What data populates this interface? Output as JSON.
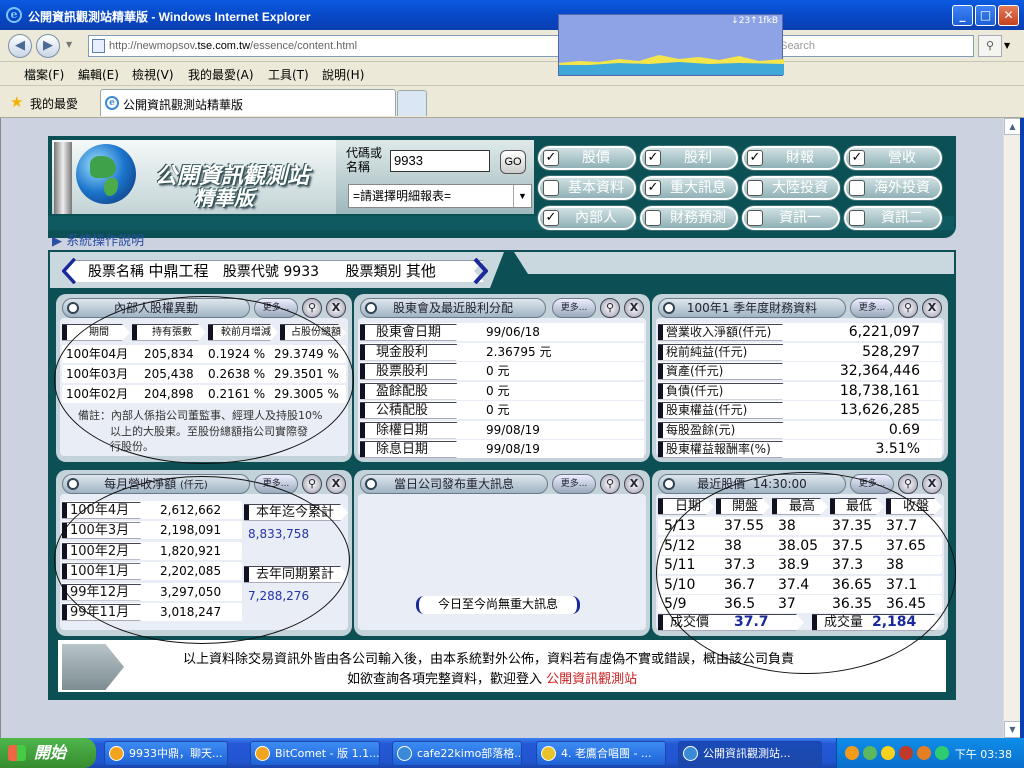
{
  "window": {
    "title": "公開資訊觀測站精華版 - Windows Internet Explorer"
  },
  "netmeter": {
    "rate": "↓23↑1fkB"
  },
  "address": {
    "url_gray1": "http://newmopsov",
    "url_black": ".tse.com.tw",
    "url_gray2": "/essence/content.html",
    "search_placeholder": "Yahoo! Search",
    "yahoo": "Y!"
  },
  "menu": [
    "檔案(F)",
    "編輯(E)",
    "檢視(V)",
    "我的最愛(A)",
    "工具(T)",
    "說明(H)"
  ],
  "favorites": {
    "label": "我的最愛",
    "tab": "公開資訊觀測站精華版"
  },
  "banner": {
    "title1": "公開資訊觀測站",
    "title2": "精華版",
    "code_label1": "代碼或",
    "code_label2": "名稱",
    "code_value": "9933",
    "go": "GO",
    "select": "=請選擇明細報表=",
    "nav": [
      {
        "label": "股價",
        "checked": true
      },
      {
        "label": "股利",
        "checked": true
      },
      {
        "label": "財報",
        "checked": true
      },
      {
        "label": "營收",
        "checked": true
      },
      {
        "label": "基本資料",
        "checked": false
      },
      {
        "label": "重大訊息",
        "checked": true
      },
      {
        "label": "大陸投資",
        "checked": false
      },
      {
        "label": "海外投資",
        "checked": false
      },
      {
        "label": "內部人",
        "checked": true
      },
      {
        "label": "財務預測",
        "checked": false
      },
      {
        "label": "資訊一",
        "checked": false
      },
      {
        "label": "資訊二",
        "checked": false
      }
    ]
  },
  "help": "▶ 系統操作說明",
  "stock": {
    "name_label": "股票名稱",
    "name": "中鼎工程",
    "code_label": "股票代號",
    "code": "9933",
    "type_label": "股票類別",
    "type": "其他"
  },
  "common": {
    "more": "更多...",
    "zoom": "🔍",
    "close": "X"
  },
  "insider": {
    "title": "內部人股權異動",
    "headers": [
      "期間",
      "持有張數",
      "較前月增減",
      "占股份總額"
    ],
    "rows": [
      [
        "100年04月",
        "205,834",
        "0.1924 %",
        "29.3749 %"
      ],
      [
        "100年03月",
        "205,438",
        "0.2638 %",
        "29.3501 %"
      ],
      [
        "100年02月",
        "204,898",
        "0.2161 %",
        "29.3005 %"
      ]
    ],
    "note1": "備註：內部人係指公司董監事、經理人及持股10%",
    "note2": "以上的大股東。至股份總額指公司實際發",
    "note3": "行股份。"
  },
  "dividend": {
    "title": "股東會及最近股利分配",
    "rows": [
      {
        "label": "股東會日期",
        "value": "99/06/18"
      },
      {
        "label": "現金股利",
        "value": "2.36795 元"
      },
      {
        "label": "股票股利",
        "value": "0 元"
      },
      {
        "label": "盈餘配股",
        "value": "0 元"
      },
      {
        "label": "公積配股",
        "value": "0 元"
      },
      {
        "label": "除權日期",
        "value": "99/08/19"
      },
      {
        "label": "除息日期",
        "value": "99/08/19"
      }
    ]
  },
  "finance": {
    "title": "100年1 季年度財務資料",
    "rows": [
      {
        "label": "營業收入淨額(仟元)",
        "value": "6,221,097"
      },
      {
        "label": "稅前純益(仟元)",
        "value": "528,297"
      },
      {
        "label": "資產(仟元)",
        "value": "32,364,446"
      },
      {
        "label": "負債(仟元)",
        "value": "18,738,161"
      },
      {
        "label": "股東權益(仟元)",
        "value": "13,626,285"
      },
      {
        "label": "每股盈餘(元)",
        "value": "0.69"
      },
      {
        "label": "股東權益報酬率(%)",
        "value": "3.51%"
      }
    ]
  },
  "revenue": {
    "title": "每月營收淨額",
    "unit": "(仟元)",
    "rows": [
      {
        "label": "100年4月",
        "value": "2,612,662"
      },
      {
        "label": "100年3月",
        "value": "2,198,091"
      },
      {
        "label": "100年2月",
        "value": "1,820,921"
      },
      {
        "label": "100年1月",
        "value": "2,202,085"
      },
      {
        "label": "99年12月",
        "value": "3,297,050"
      },
      {
        "label": "99年11月",
        "value": "3,018,247"
      }
    ],
    "ytd_label": "本年迄今累計",
    "ytd_value": "8,833,758",
    "lastyear_label": "去年同期累計",
    "lastyear_value": "7,288,276"
  },
  "news": {
    "title": "當日公司發布重大訊息",
    "empty": "今日至今尚無重大訊息"
  },
  "price": {
    "title": "最近股價",
    "time": "14:30:00",
    "headers": [
      "日期",
      "開盤",
      "最高",
      "最低",
      "收盤"
    ],
    "rows": [
      [
        "5/13",
        "37.55",
        "38",
        "37.35",
        "37.7"
      ],
      [
        "5/12",
        "38",
        "38.05",
        "37.5",
        "37.65"
      ],
      [
        "5/11",
        "37.3",
        "38.9",
        "37.3",
        "38"
      ],
      [
        "5/10",
        "36.7",
        "37.4",
        "36.65",
        "37.1"
      ],
      [
        "5/9",
        "36.5",
        "37",
        "36.35",
        "36.45"
      ]
    ],
    "deal_label": "成交價",
    "deal": "37.7",
    "vol_label": "成交量",
    "vol": "2,184"
  },
  "footer": {
    "line1": "以上資料除交易資訊外皆由各公司輸入後，由本系統對外公佈，資料若有虛偽不實或錯誤，概由該公司負責",
    "line2": "如欲查詢各項完整資料，歡迎登入",
    "link": "公開資訊觀測站"
  },
  "taskbar": {
    "start": "開始",
    "tasks": [
      "9933中鼎，聊天...",
      "BitComet - 版 1.1...",
      "cafe22kimo部落格...",
      "4. 老鷹合唱團 - ...",
      "公開資訊觀測站..."
    ],
    "clock": "下午 03:38"
  },
  "colors": {
    "teal": "#0c4f55",
    "panel": "#c4d3da",
    "titlebar": "#0848c8"
  }
}
